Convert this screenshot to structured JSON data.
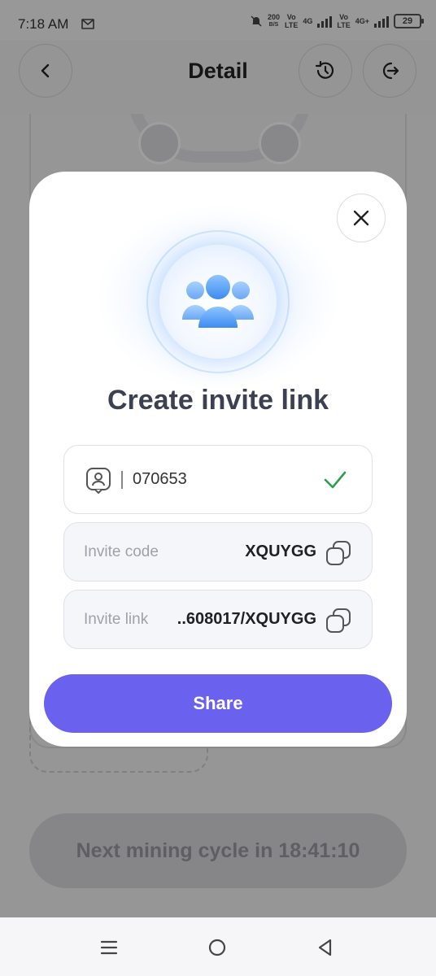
{
  "status_bar": {
    "time": "7:18 AM",
    "net_speed_value": "200",
    "net_speed_unit": "B/S",
    "sim1_label": "Vo",
    "sim1_sub": "LTE",
    "sim1_net": "4G",
    "sim2_label": "Vo",
    "sim2_sub": "LTE",
    "sim2_net": "4G+",
    "battery": "29"
  },
  "header": {
    "title": "Detail"
  },
  "background": {
    "next_cycle_label": "Next mining cycle in 18:41:10"
  },
  "modal": {
    "title": "Create invite link",
    "id_value": "070653",
    "invite_code_label": "Invite code",
    "invite_code_value": "XQUYGG",
    "invite_link_label": "Invite link",
    "invite_link_value": "..608017/XQUYGG",
    "share_label": "Share"
  },
  "colors": {
    "accent": "#6a62ee",
    "check": "#2e9e4f",
    "hero_blue": "#5aa2ff"
  },
  "icons": {
    "header": [
      "back-icon",
      "history-icon",
      "logout-icon"
    ],
    "modal": [
      "close-icon",
      "users-group-icon",
      "user-badge-icon",
      "check-icon",
      "copy-icon"
    ],
    "nav": [
      "menu-icon",
      "home-icon",
      "back-triangle-icon"
    ]
  }
}
